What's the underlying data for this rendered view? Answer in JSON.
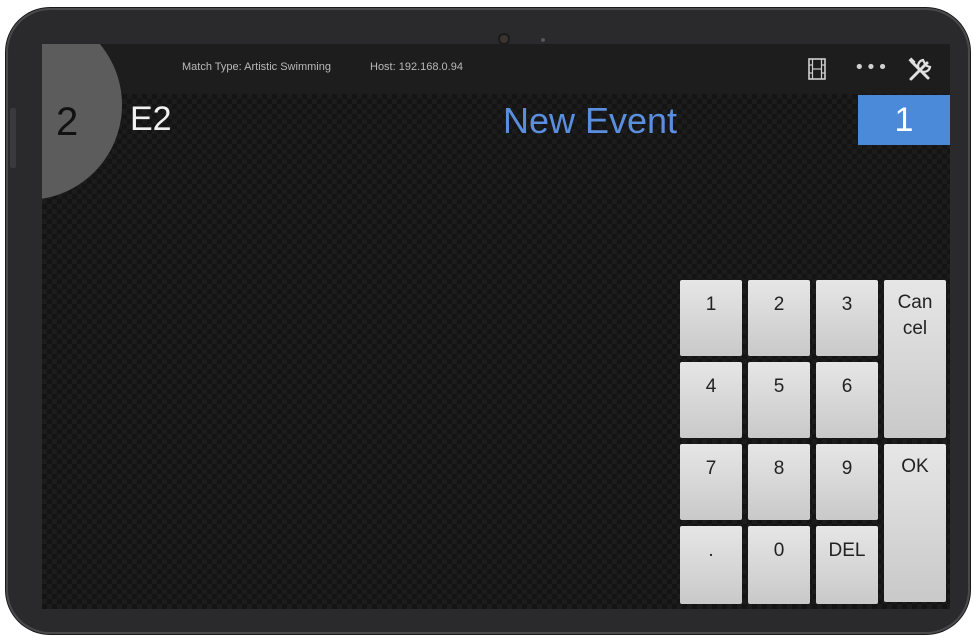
{
  "status_bar": {
    "match_type": "Match Type: Artistic Swimming",
    "host": "Host: 192.168.0.94",
    "connection_icon": "((☶))"
  },
  "header": {
    "judge_number": "2",
    "judge_code": "E2",
    "event_title": "New Event",
    "counter": "1"
  },
  "keypad": {
    "keys": {
      "k1": "1",
      "k2": "2",
      "k3": "3",
      "k4": "4",
      "k5": "5",
      "k6": "6",
      "k7": "7",
      "k8": "8",
      "k9": "9",
      "kdot": ".",
      "k0": "0",
      "kdel": "DEL"
    },
    "cancel_line1": "Can",
    "cancel_line2": "cel",
    "ok": "OK"
  },
  "colors": {
    "accent_blue": "#4a8ad8",
    "title_blue": "#5a8fe0",
    "background": "#141414"
  },
  "icons": [
    "wifi-signal-icon",
    "film-icon",
    "more-icon",
    "tools-icon"
  ]
}
